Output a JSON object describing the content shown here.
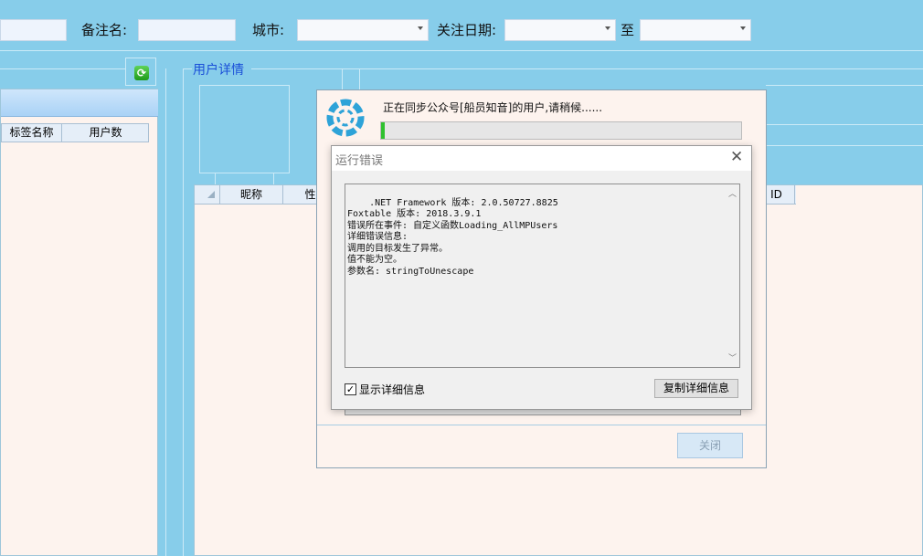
{
  "filters": {
    "remark_label": "备注名:",
    "city_label": "城市:",
    "follow_date_label": "关注日期:",
    "to_label": "至"
  },
  "left_panel": {
    "columns": [
      "标签名称",
      "用户数"
    ]
  },
  "section_title": "用户详情",
  "right_grid": {
    "columns": [
      "昵称",
      "性",
      "ID"
    ]
  },
  "progress_dialog": {
    "message": "正在同步公众号[船员知音]的用户,请稍候......",
    "progress_percent": 1,
    "close_label": "关闭"
  },
  "error_dialog": {
    "title": "运行错误",
    "details": ".NET Framework 版本: 2.0.50727.8825\nFoxtable 版本: 2018.3.9.1\n错误所在事件: 自定义函数Loading_AllMPUsers\n详细错误信息:\n调用的目标发生了异常。\n值不能为空。\n参数名: stringToUnescape",
    "show_details_label": "显示详细信息",
    "copy_label": "复制详细信息",
    "show_details_checked": true
  },
  "colors": {
    "background": "#87cdea",
    "panel": "#fdf3ee",
    "title_blue": "#1a4fd8",
    "progress_green": "#2fc12f"
  }
}
